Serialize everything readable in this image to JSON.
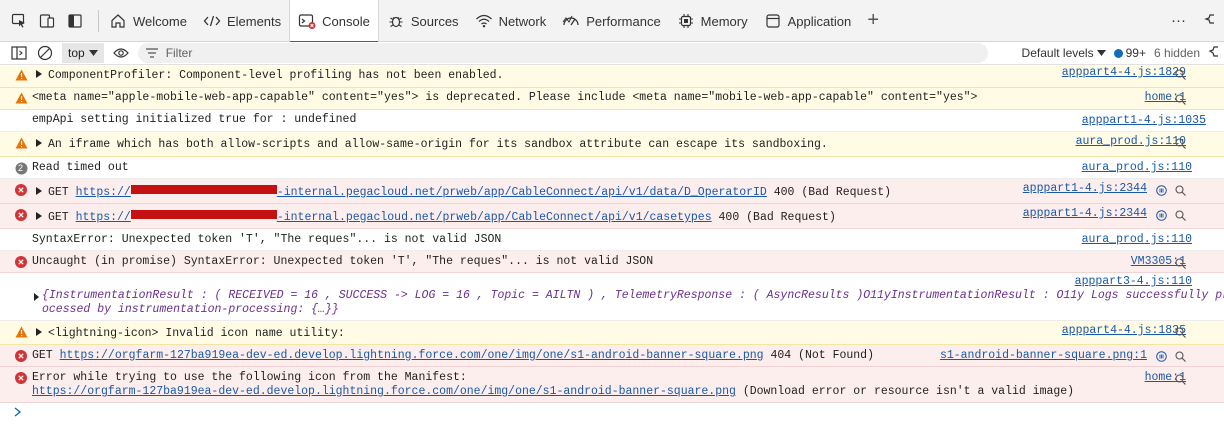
{
  "tabs": [
    {
      "label": "Welcome",
      "icon": "home-icon"
    },
    {
      "label": "Elements",
      "icon": "code-icon"
    },
    {
      "label": "Console",
      "icon": "console-icon",
      "active": true
    },
    {
      "label": "Sources",
      "icon": "bug-icon"
    },
    {
      "label": "Network",
      "icon": "wifi-icon"
    },
    {
      "label": "Performance",
      "icon": "performance-icon"
    },
    {
      "label": "Memory",
      "icon": "memory-chip-icon"
    },
    {
      "label": "Application",
      "icon": "application-icon"
    }
  ],
  "toolbar": {
    "context": "top",
    "filter_placeholder": "Filter",
    "levels": "Default levels",
    "issues_count": "99+",
    "hidden": "6 hidden"
  },
  "messages": [
    {
      "level": "warning",
      "text": "ComponentProfiler: Component-level profiling has not been enabled.",
      "source": "apppart4-4.js:1829"
    },
    {
      "level": "warning",
      "text": "<meta name=\"apple-mobile-web-app-capable\" content=\"yes\"> is deprecated. Please include <meta name=\"mobile-web-app-capable\" content=\"yes\">",
      "source": "home:1"
    },
    {
      "level": "info",
      "text": "empApi setting initialized true for : undefined",
      "source": "apppart1-4.js:1035"
    },
    {
      "level": "warning",
      "text": "An iframe which has both allow-scripts and allow-same-origin for its sandbox attribute can escape its sandboxing.",
      "source": "aura_prod.js:110"
    },
    {
      "level": "info",
      "count": "2",
      "text": "Read timed out",
      "source": "aura_prod.js:110"
    },
    {
      "level": "error",
      "method": "GET",
      "url_prefix": "https://",
      "url_suffix": "-internal.pegacloud.net/prweb/app/CableConnect/api/v1/data/D_OperatorID",
      "status": "400 (Bad Request)",
      "source": "apppart1-4.js:2344"
    },
    {
      "level": "error",
      "method": "GET",
      "url_prefix": "https://",
      "url_suffix": "-internal.pegacloud.net/prweb/app/CableConnect/api/v1/casetypes",
      "status": "400 (Bad Request)",
      "source": "apppart1-4.js:2344"
    },
    {
      "level": "info",
      "text": "SyntaxError: Unexpected token 'T', \"The reques\"... is not valid JSON",
      "source": "aura_prod.js:110"
    },
    {
      "level": "error",
      "text": "Uncaught (in promise) SyntaxError: Unexpected token 'T', \"The reques\"... is not valid JSON",
      "source": "VM3305:1"
    },
    {
      "level": "info",
      "source": "apppart3-4.js:110",
      "object_line1": "{InstrumentationResult :  ( RECEIVED = 16 , SUCCESS -> LOG = 16 , Topic = AILTN )  , TelemetryResponse : ( AsyncResults )O11yInstrumentationResult : O11y Logs successfully pr",
      "object_line2": "ocessed by instrumentation-processing: {…}}"
    },
    {
      "level": "warning",
      "text": "<lightning-icon> Invalid icon name utility:",
      "source": "apppart4-4.js:1835"
    },
    {
      "level": "error",
      "method": "GET",
      "url": "https://orgfarm-127ba919ea-dev-ed.develop.lightning.force.com/one/img/one/s1-android-banner-square.png",
      "status": "404 (Not Found)",
      "source": "s1-android-banner-square.png:1"
    },
    {
      "level": "error",
      "text": "Error while trying to use the following icon from the Manifest:",
      "url": "https://orgfarm-127ba919ea-dev-ed.develop.lightning.force.com/one/img/one/s1-android-banner-square.png",
      "tail": "(Download error or resource isn't a valid image)",
      "source": "home:1"
    }
  ],
  "colors": {
    "warning_bg": "#fffbe5",
    "error_bg": "#fdeeee",
    "accent": "#0f6cbd",
    "link": "#1a58a8"
  }
}
